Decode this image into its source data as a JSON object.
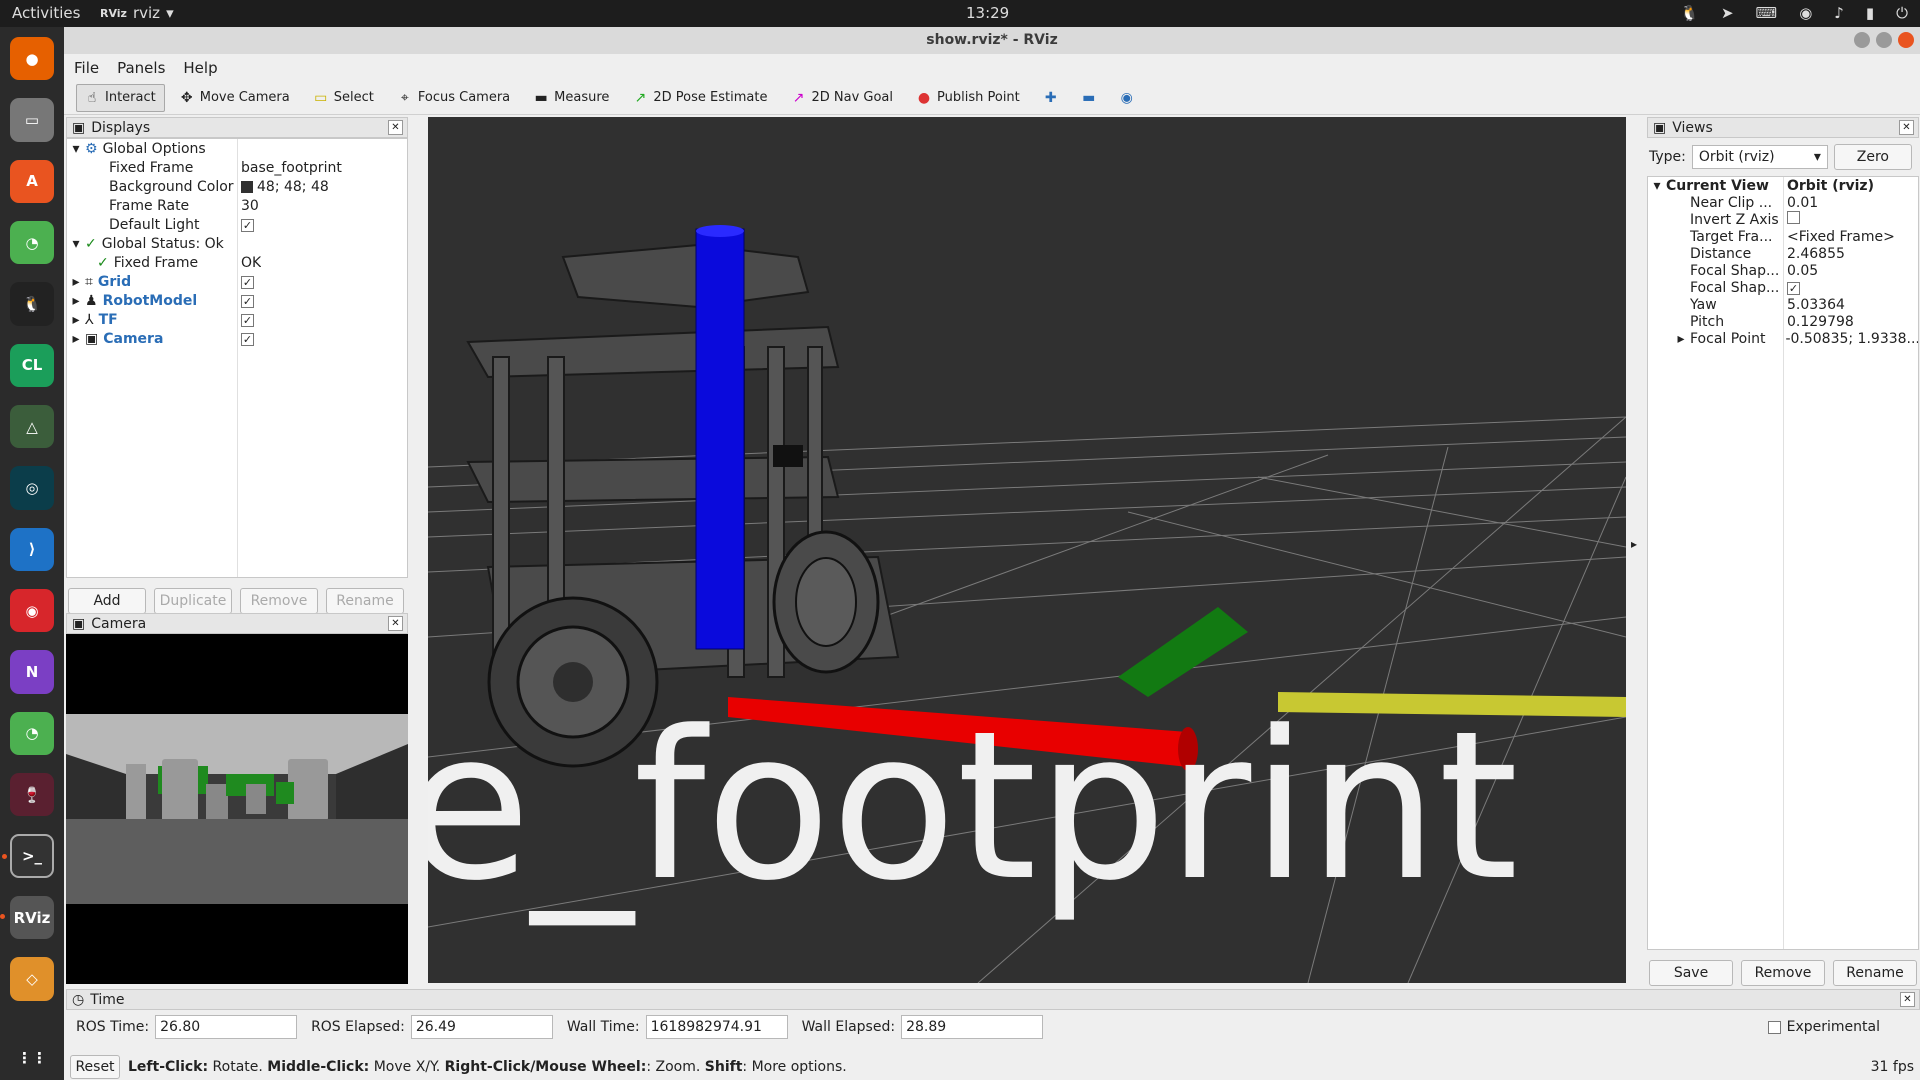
{
  "topbar": {
    "activities": "Activities",
    "app": "rviz",
    "clock": "13:29"
  },
  "dock": [
    "Firefox",
    "Files",
    "Software",
    "WeChat",
    "QQ",
    "CL",
    "Qt",
    "GitKraken",
    "VS Code",
    "NetEase",
    "N",
    "WeChat",
    "Wine",
    "Terminal",
    "RViz",
    "Layers",
    "Apps"
  ],
  "window": {
    "title": "show.rviz* - RViz"
  },
  "menu": {
    "file": "File",
    "panels": "Panels",
    "help": "Help"
  },
  "toolbar": {
    "interact": "Interact",
    "move_camera": "Move Camera",
    "select": "Select",
    "focus_camera": "Focus Camera",
    "measure": "Measure",
    "pose_estimate": "2D Pose Estimate",
    "nav_goal": "2D Nav Goal",
    "publish_point": "Publish Point"
  },
  "displays": {
    "title": "Displays",
    "global_options": "Global Options",
    "fixed_frame_label": "Fixed Frame",
    "fixed_frame_value": "base_footprint",
    "bg_color_label": "Background Color",
    "bg_color_value": "48; 48; 48",
    "frame_rate_label": "Frame Rate",
    "frame_rate_value": "30",
    "default_light_label": "Default Light",
    "global_status": "Global Status: Ok",
    "status_fixed_frame": "Fixed Frame",
    "status_fixed_frame_value": "OK",
    "grid": "Grid",
    "robot_model": "RobotModel",
    "tf": "TF",
    "camera": "Camera",
    "add": "Add",
    "duplicate": "Duplicate",
    "remove": "Remove",
    "rename": "Rename"
  },
  "camera_panel": {
    "title": "Camera"
  },
  "viewport": {
    "label": "se_footprint"
  },
  "views": {
    "title": "Views",
    "type_label": "Type:",
    "type_value": "Orbit (rviz)",
    "zero": "Zero",
    "current_view": "Current View",
    "current_view_value": "Orbit (rviz)",
    "rows": [
      {
        "k": "Near Clip ...",
        "v": "0.01"
      },
      {
        "k": "Invert Z Axis",
        "v": ""
      },
      {
        "k": "Target Fra...",
        "v": "<Fixed Frame>"
      },
      {
        "k": "Distance",
        "v": "2.46855"
      },
      {
        "k": "Focal Shap...",
        "v": "0.05"
      },
      {
        "k": "Focal Shap...",
        "v": ""
      },
      {
        "k": "Yaw",
        "v": "5.03364"
      },
      {
        "k": "Pitch",
        "v": "0.129798"
      },
      {
        "k": "Focal Point",
        "v": "-0.50835; 1.9338..."
      }
    ],
    "save": "Save",
    "remove": "Remove",
    "rename": "Rename"
  },
  "time": {
    "title": "Time",
    "ros_time_label": "ROS Time:",
    "ros_time": "26.80",
    "ros_elapsed_label": "ROS Elapsed:",
    "ros_elapsed": "26.49",
    "wall_time_label": "Wall Time:",
    "wall_time": "1618982974.91",
    "wall_elapsed_label": "Wall Elapsed:",
    "wall_elapsed": "28.89",
    "experimental": "Experimental"
  },
  "status": {
    "reset": "Reset",
    "left_click": "Left-Click:",
    "left_click_text": "Rotate.",
    "middle_click": "Middle-Click:",
    "middle_click_text": "Move X/Y.",
    "right_click": "Right-Click/Mouse Wheel:",
    "right_click_text": ": Zoom.",
    "shift": "Shift",
    "shift_text": ": More options.",
    "fps": "31 fps"
  }
}
